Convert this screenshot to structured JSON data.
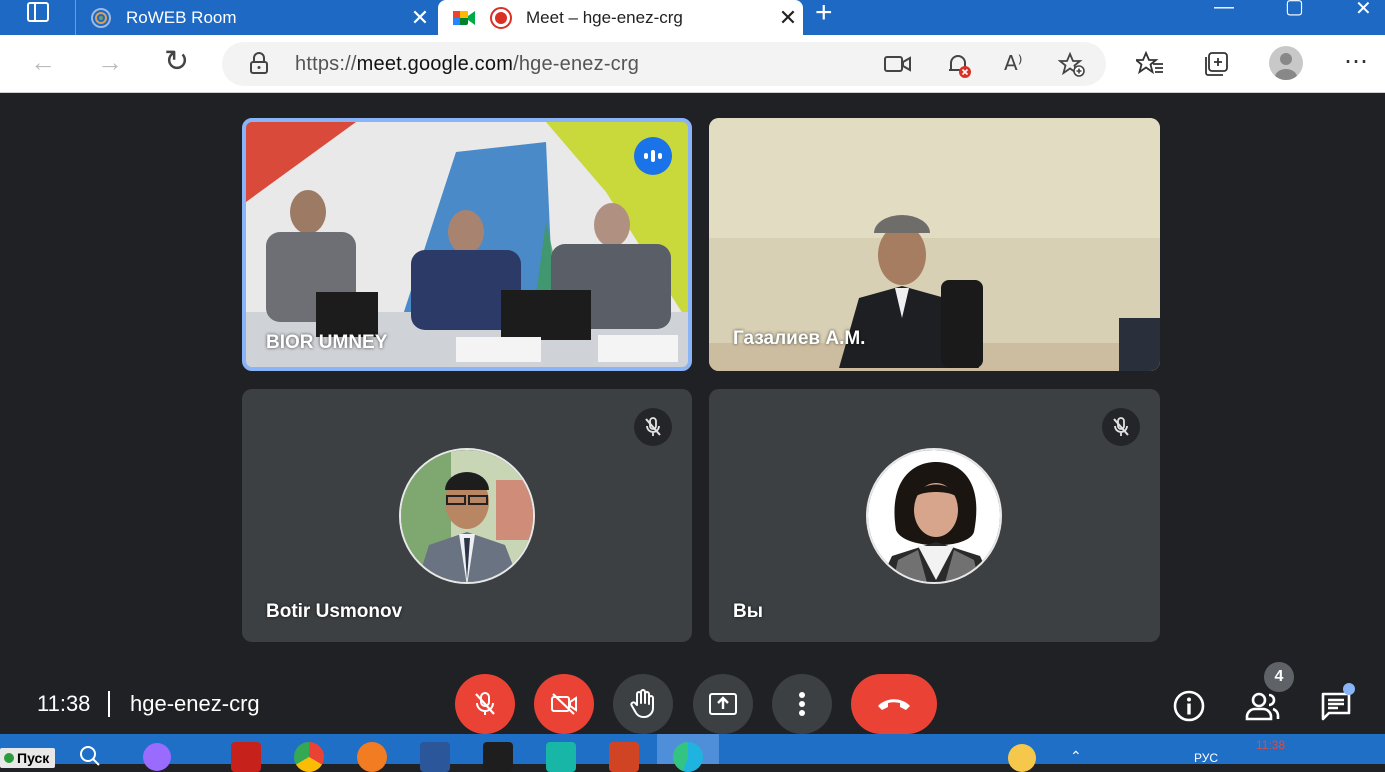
{
  "browser": {
    "tabs": [
      {
        "title": "RoWEB Room",
        "active": false
      },
      {
        "title": "Meet – hge-enez-crg",
        "active": true
      }
    ],
    "close_glyph": "✕",
    "new_tab_glyph": "+",
    "url_prefix": "https://",
    "url_domain": "meet.google.com",
    "url_path": "/hge-enez-crg"
  },
  "participants": [
    {
      "name": "BIOR UMNEY",
      "speaking": true
    },
    {
      "name": "Газалиев А.М.",
      "muted": false
    },
    {
      "name": "Botir Usmonov",
      "muted": true
    },
    {
      "name": "Вы",
      "muted": true
    }
  ],
  "controls": {
    "time": "11:38",
    "meeting_code": "hge-enez-crg",
    "people_count": "4"
  },
  "taskbar": {
    "start_label": "Пуск",
    "lang": "РУС",
    "clock": "11:38"
  },
  "colors": {
    "titlebar": "#1d69c4",
    "meet_bg": "#202124",
    "tile_bg": "#3c4043",
    "red_button": "#ea4335",
    "speaker_ring": "#8ab4f8"
  }
}
